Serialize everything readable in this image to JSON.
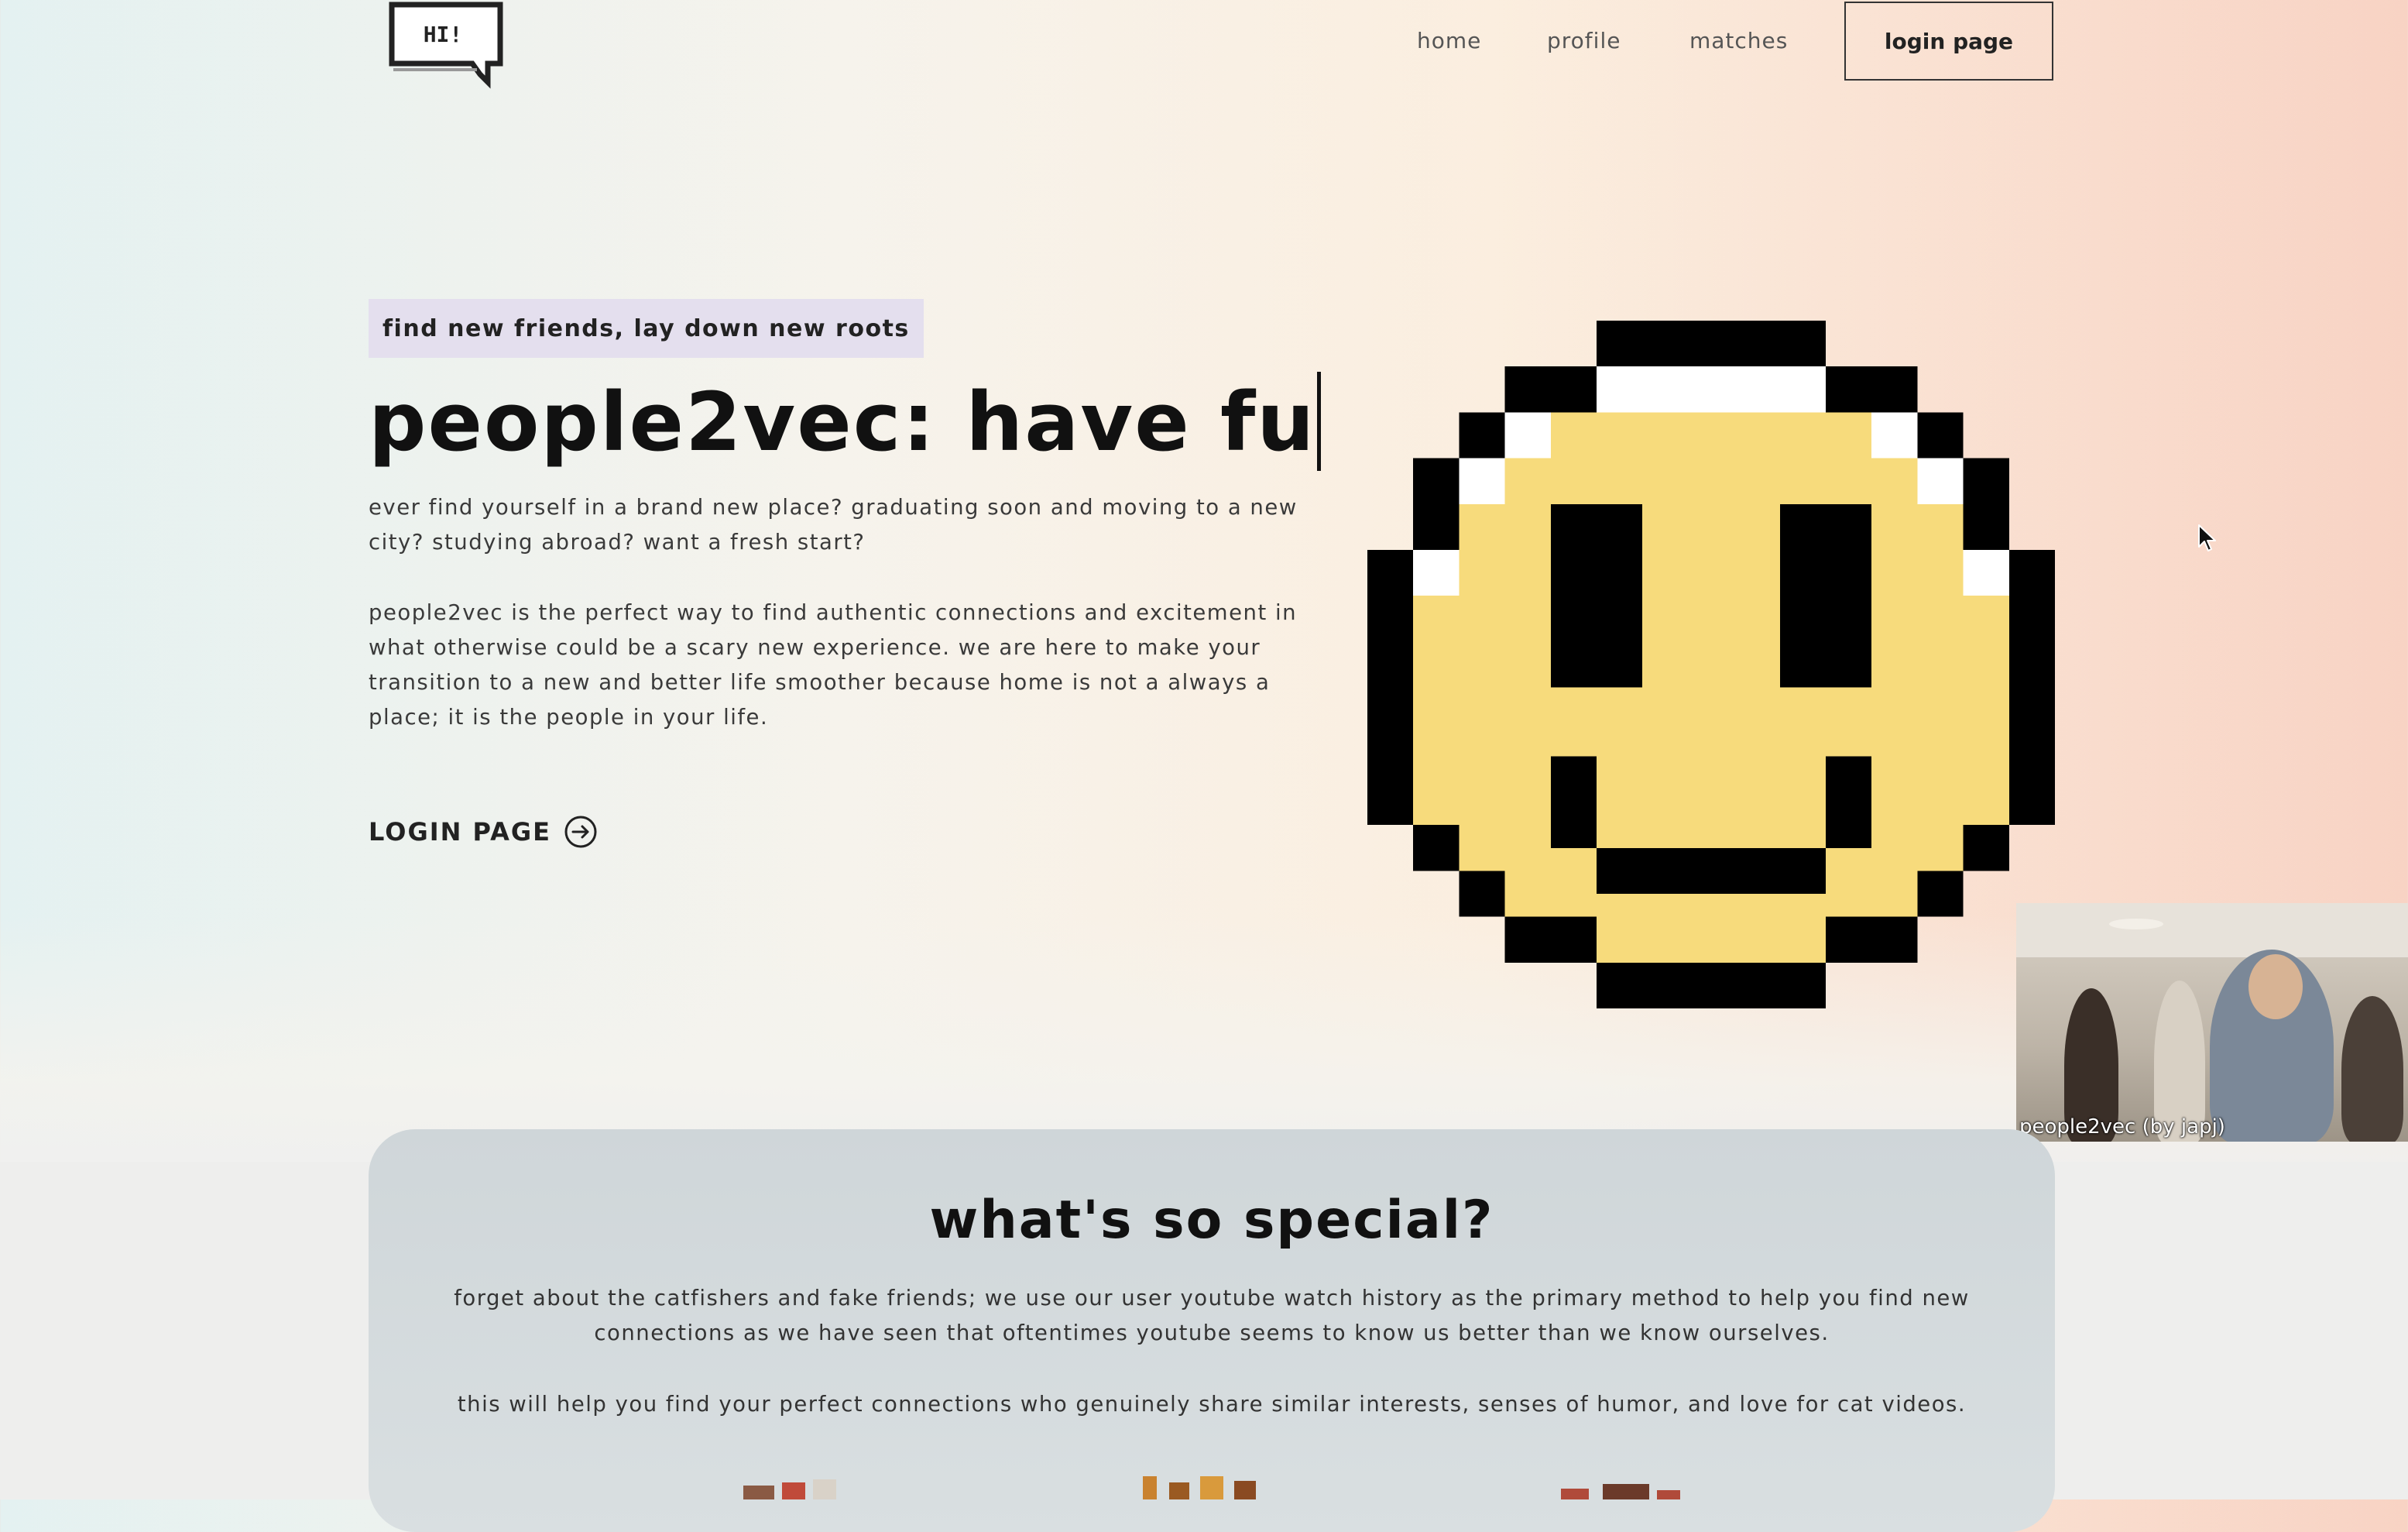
{
  "header": {
    "logo_text": "HI!",
    "nav": {
      "home": "home",
      "profile": "profile",
      "matches": "matches"
    },
    "login_button": "login page"
  },
  "hero": {
    "tagline": "find new friends, lay down new roots",
    "title": "people2vec: have fu",
    "paragraph_1": "ever find yourself in a brand new place? graduating soon and moving to a new city? studying abroad? want a fresh start?",
    "paragraph_2": "people2vec is the perfect way to find authentic connections and excitement in what otherwise could be a scary new experience. we are here to make your transition to a new and better life smoother because home is not a always a place; it is the people in your life.",
    "link_label": "LOGIN PAGE",
    "link_icon": "arrow-right-circle-icon"
  },
  "webcam": {
    "caption": "people2vec (by japj)"
  },
  "special": {
    "title": "what's so special?",
    "paragraph_1": "forget about the catfishers and fake friends; we use our user youtube watch history as the primary method to help you find new connections as we have seen that oftentimes youtube seems to know us better than we know ourselves.",
    "paragraph_2": "this will help you find your perfect connections who genuinely share similar interests, senses of humor, and love for cat videos."
  },
  "colors": {
    "smiley_yellow": "#f7db7c",
    "tag_bg": "#e4dfee",
    "card_bg": "#d3dadc"
  }
}
